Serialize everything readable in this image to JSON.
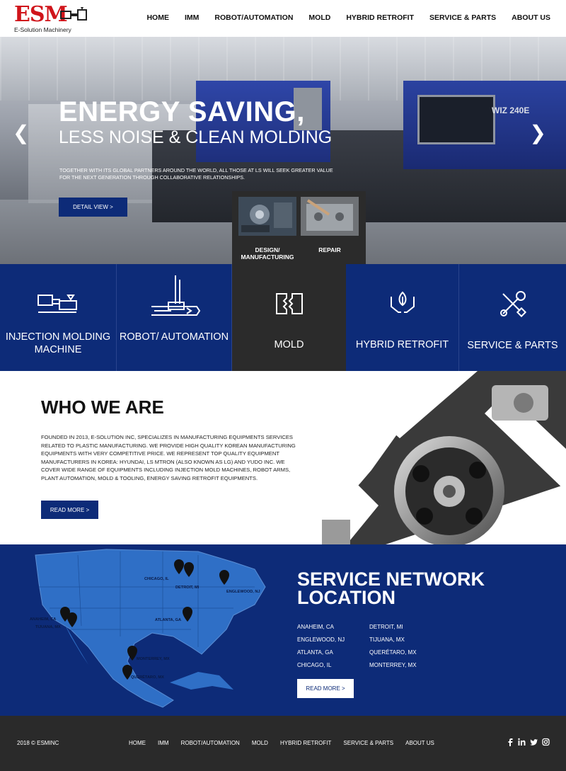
{
  "brand": {
    "logo_text": "ESM",
    "tagline": "E-Solution Machinery"
  },
  "nav": [
    "HOME",
    "IMM",
    "ROBOT/AUTOMATION",
    "MOLD",
    "HYBRID RETROFIT",
    "SERVICE & PARTS",
    "ABOUT US"
  ],
  "hero": {
    "title_line1": "ENERGY SAVING,",
    "title_line2": "LESS NOISE & CLEAN MOLDING",
    "description": "TOGETHER WITH ITS GLOBAL PARTNERS AROUND THE WORLD, ALL THOSE AT LS WILL SEEK GREATER VALUE FOR THE NEXT GENERATION THROUGH COLLABORATIVE RELATIONSHIPS.",
    "button": "DETAIL VIEW >",
    "machine_label": "WIZ 240E",
    "prev_arrow": "❮",
    "next_arrow": "❯"
  },
  "mold_submenu": {
    "items": [
      "DESIGN/ MANUFACTURING",
      "REPAIR"
    ]
  },
  "tiles": [
    {
      "label": "INJECTION MOLDING MACHINE",
      "icon": "injection-machine-icon"
    },
    {
      "label": "ROBOT/ AUTOMATION",
      "icon": "robot-arm-icon"
    },
    {
      "label": "MOLD",
      "icon": "mold-icon"
    },
    {
      "label": "HYBRID RETROFIT",
      "icon": "leaf-hands-icon"
    },
    {
      "label": "SERVICE & PARTS",
      "icon": "tools-icon"
    }
  ],
  "who": {
    "title": "WHO WE ARE",
    "text": "FOUNDED IN 2013, E-SOLUTION INC, SPECIALIZES IN MANUFACTURING EQUIPMENTS SERVICES RELATED TO PLASTIC MANUFACTURING. WE PROVIDE HIGH QUALITY KOREAN MANUFACTURING EQUIPMENTS WITH VERY COMPETITIVE PRICE. WE REPRESENT TOP QUALITY EQUIPMENT MANUFACTURERS IN KOREA: HYUNDAI, LS MTRON (ALSO KNOWN AS LG) AND YUDO INC. WE COVER WIDE RANGE OF EQUIPMENTS INCLUDING INJECTION MOLD MACHINES, ROBOT ARMS, PLANT AUTOMATION, MOLD & TOOLING, ENERGY SAVING RETROFIT EQUIPMENTS.",
    "button": "READ MORE >"
  },
  "network": {
    "title_line1": "SERVICE NETWORK",
    "title_line2": "LOCATION",
    "locations": [
      "ANAHEIM, CA",
      "DETROIT, MI",
      "ENGLEWOOD, NJ",
      "TIJUANA, MX",
      "ATLANTA, GA",
      "QUERÉTARO, MX",
      "CHICAGO, IL",
      "MONTERREY, MX"
    ],
    "map_labels": [
      "CHICAGO, IL",
      "DETROIT, MI",
      "ENGLEWOOD, NJ",
      "ANAHEIM, CA",
      "TIJUANA, MX",
      "ATLANTA, GA",
      "MONTERREY, MX",
      "QUERÉTARO, MX"
    ],
    "button": "READ MORE >"
  },
  "footer": {
    "copyright": "2018 © ESMINC",
    "nav": [
      "HOME",
      "IMM",
      "ROBOT/AUTOMATION",
      "MOLD",
      "HYBRID RETROFIT",
      "SERVICE & PARTS",
      "ABOUT US"
    ],
    "social": [
      "facebook-icon",
      "linkedin-icon",
      "twitter-icon",
      "instagram-icon"
    ]
  },
  "colors": {
    "brand_red": "#d0151b",
    "navy": "#0d2b78",
    "dark": "#2b2b2b",
    "footer": "#2a2a2a",
    "map_blue": "#2f6fc6"
  }
}
